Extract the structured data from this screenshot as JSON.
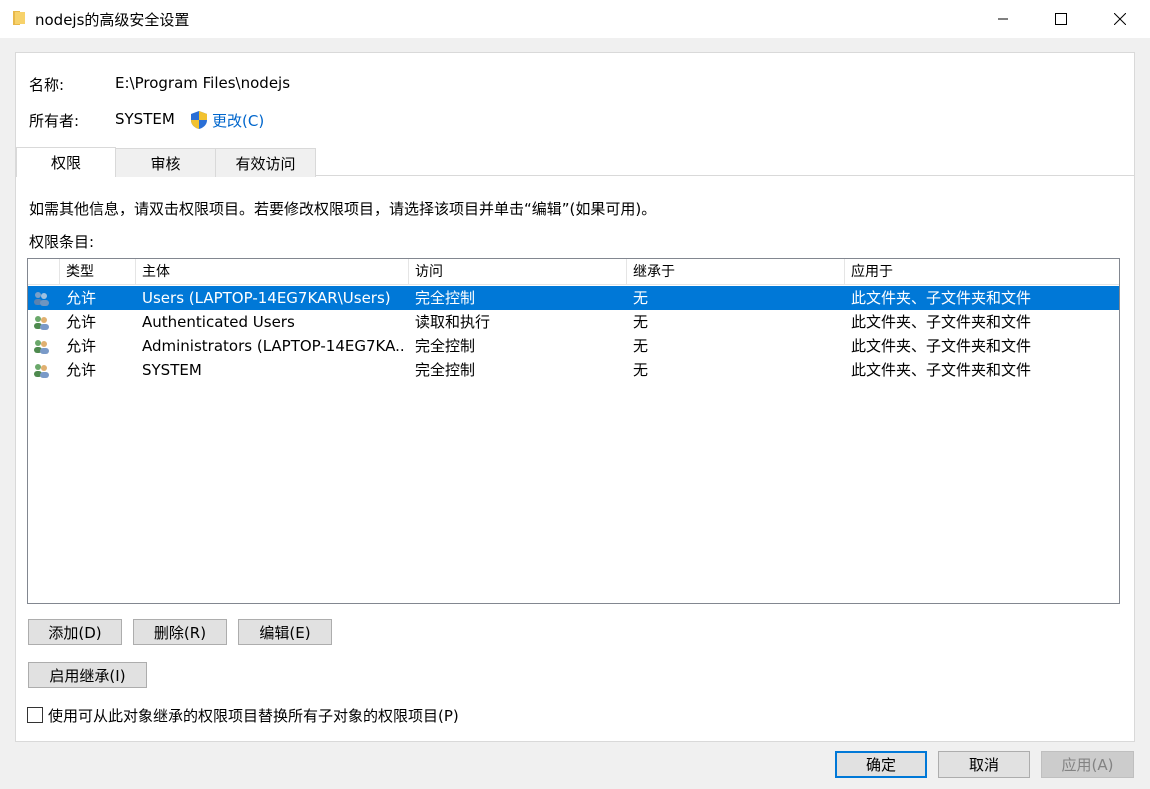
{
  "window": {
    "title": "nodejs的高级安全设置"
  },
  "fields": {
    "name_label": "名称:",
    "name_value": "E:\\Program Files\\nodejs",
    "owner_label": "所有者:",
    "owner_value": "SYSTEM",
    "change_link": "更改(C)"
  },
  "tabs": [
    {
      "label": "权限"
    },
    {
      "label": "审核"
    },
    {
      "label": "有效访问"
    }
  ],
  "info_text": "如需其他信息，请双击权限项目。若要修改权限项目，请选择该项目并单击“编辑”(如果可用)。",
  "entries_label": "权限条目:",
  "table": {
    "columns": [
      "类型",
      "主体",
      "访问",
      "继承于",
      "应用于"
    ],
    "rows": [
      {
        "type": "允许",
        "principal": "Users (LAPTOP-14EG7KAR\\Users)",
        "access": "完全控制",
        "inherited": "无",
        "applies": "此文件夹、子文件夹和文件",
        "selected": true
      },
      {
        "type": "允许",
        "principal": "Authenticated Users",
        "access": "读取和执行",
        "inherited": "无",
        "applies": "此文件夹、子文件夹和文件",
        "selected": false
      },
      {
        "type": "允许",
        "principal": "Administrators (LAPTOP-14EG7KA...",
        "access": "完全控制",
        "inherited": "无",
        "applies": "此文件夹、子文件夹和文件",
        "selected": false
      },
      {
        "type": "允许",
        "principal": "SYSTEM",
        "access": "完全控制",
        "inherited": "无",
        "applies": "此文件夹、子文件夹和文件",
        "selected": false
      }
    ]
  },
  "buttons": {
    "add": "添加(D)",
    "remove": "删除(R)",
    "edit": "编辑(E)",
    "enable_inheritance": "启用继承(I)",
    "ok": "确定",
    "cancel": "取消",
    "apply": "应用(A)"
  },
  "checkbox": {
    "label": "使用可从此对象继承的权限项目替换所有子对象的权限项目(P)",
    "checked": false
  },
  "colors": {
    "selection": "#0078d7",
    "link": "#0066cc"
  }
}
